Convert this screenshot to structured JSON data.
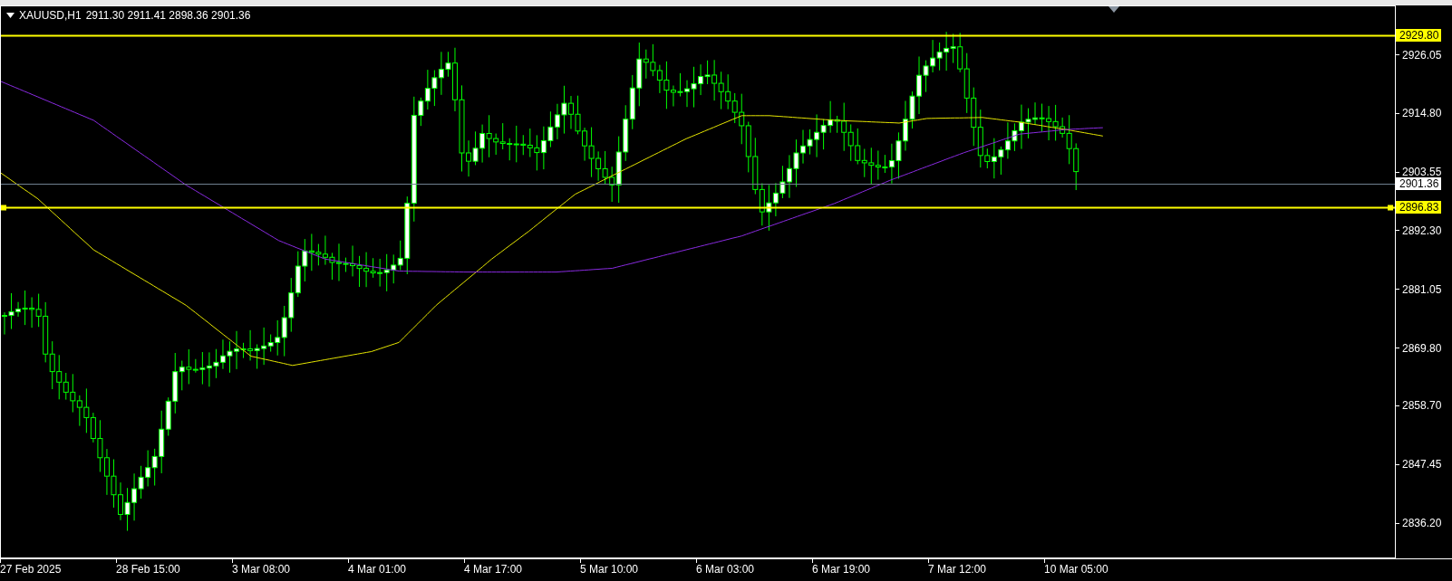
{
  "chart_header": {
    "symbol": "XAUUSD,H1",
    "quotes": "2911.30 2911.41 2898.36 2901.36"
  },
  "price_axis": {
    "ticks": [
      "2926.05",
      "2914.80",
      "2903.55",
      "2892.30",
      "2881.05",
      "2869.80",
      "2858.70",
      "2847.45",
      "2836.20"
    ]
  },
  "price_markers": [
    {
      "kind": "level",
      "label": "2929.80",
      "color": "#ffff00"
    },
    {
      "kind": "bid",
      "label": "2901.36",
      "color": "#ffffff"
    },
    {
      "kind": "selected_level",
      "label": "2896.83",
      "color": "#ffff00"
    }
  ],
  "time_axis": {
    "labels": [
      "27 Feb 2025",
      "28 Feb 15:00",
      "3 Mar 08:00",
      "4 Mar 01:00",
      "4 Mar 17:00",
      "5 Mar 10:00",
      "6 Mar 03:00",
      "6 Mar 19:00",
      "7 Mar 12:00",
      "10 Mar 05:00"
    ]
  }
}
